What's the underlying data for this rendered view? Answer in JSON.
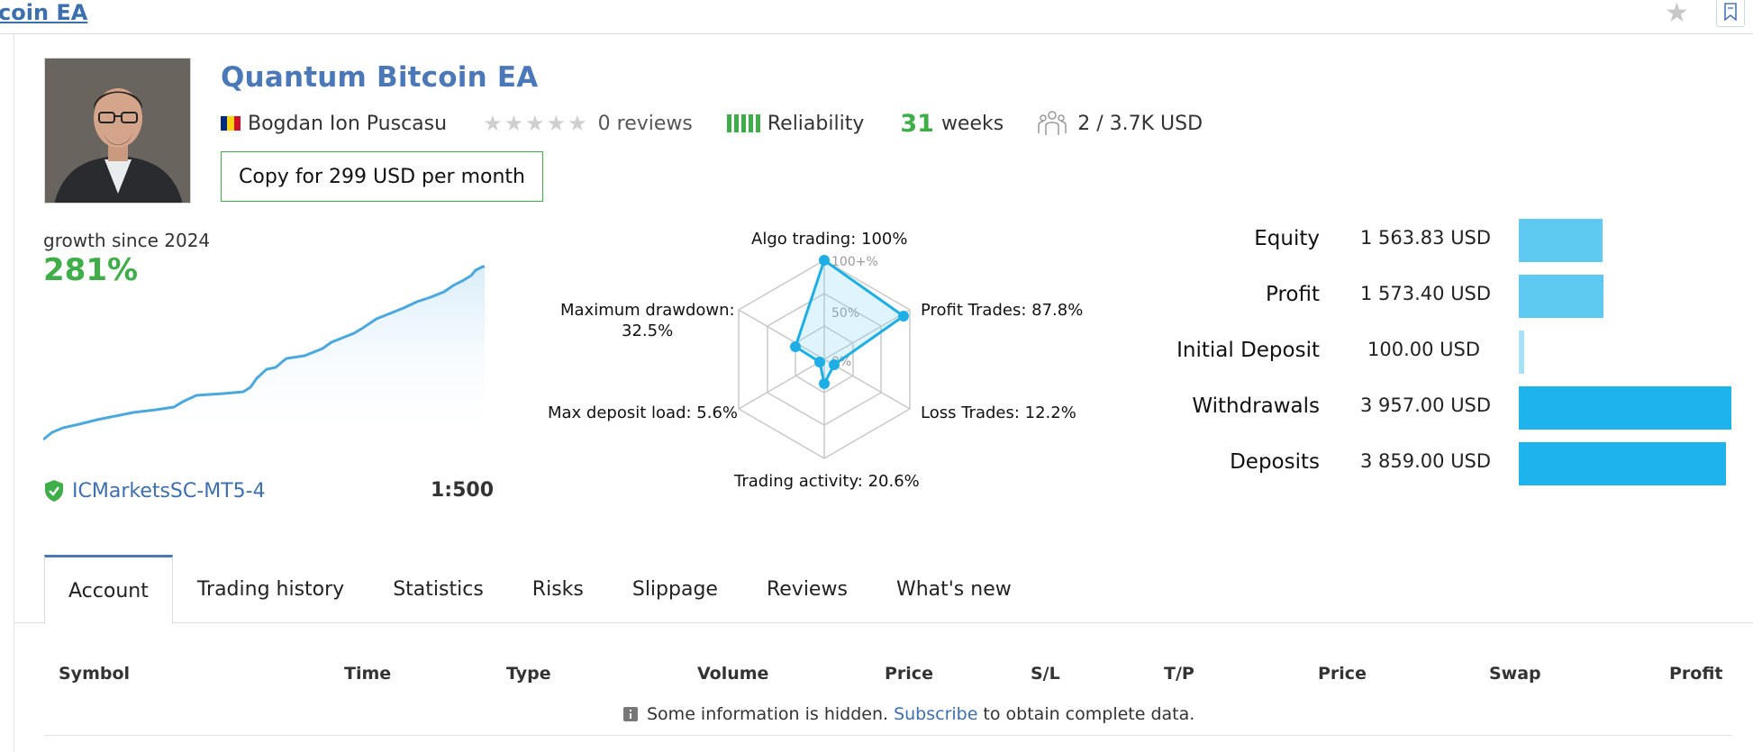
{
  "topbar": {
    "link_text": "coin EA"
  },
  "product": {
    "title": "Quantum Bitcoin EA",
    "author": "Bogdan Ion Puscasu",
    "reviews": "0 reviews",
    "reliability_label": "Reliability",
    "weeks_num": "31",
    "weeks_label": "weeks",
    "subscribers": "2 / 3.7K USD",
    "copy_button": "Copy for 299 USD per month",
    "flag_colors": [
      "#002b7f",
      "#fcd116",
      "#ce1126"
    ]
  },
  "growth": {
    "label": "growth since 2024",
    "value": "281%",
    "broker": "ICMarketsSC-MT5-4",
    "leverage": "1:500",
    "line_color": "#4aa8df"
  },
  "radar": {
    "labels": {
      "algo": "Algo trading: 100%",
      "profit": "Profit Trades: 87.8%",
      "loss": "Loss Trades: 12.2%",
      "activity": "Trading activity: 20.6%",
      "deposit_load": "Max deposit load: 5.6%",
      "drawdown_1": "Maximum drawdown:",
      "drawdown_2": "32.5%"
    },
    "ring_labels": [
      "100+%",
      "50%",
      "0%"
    ]
  },
  "stats": [
    {
      "label": "Equity",
      "value": "1 563.83 USD",
      "fraction": 0.395,
      "color": "#5ec9f1"
    },
    {
      "label": "Profit",
      "value": "1 573.40 USD",
      "fraction": 0.397,
      "color": "#5ec9f1"
    },
    {
      "label": "Initial Deposit",
      "value": "100.00 USD",
      "fraction": 0.025,
      "color": "#a9e2f7"
    },
    {
      "label": "Withdrawals",
      "value": "3 957.00 USD",
      "fraction": 1.0,
      "color": "#1eb3ec"
    },
    {
      "label": "Deposits",
      "value": "3 859.00 USD",
      "fraction": 0.975,
      "color": "#1eb3ec"
    }
  ],
  "tabs": [
    "Account",
    "Trading history",
    "Statistics",
    "Risks",
    "Slippage",
    "Reviews",
    "What's new"
  ],
  "table": {
    "headers": [
      "Symbol",
      "Time",
      "Type",
      "Volume",
      "Price",
      "S/L",
      "T/P",
      "Price",
      "Swap",
      "Profit"
    ],
    "notice_before": "Some information is hidden.",
    "notice_link": "Subscribe",
    "notice_after": "to obtain complete data."
  }
}
